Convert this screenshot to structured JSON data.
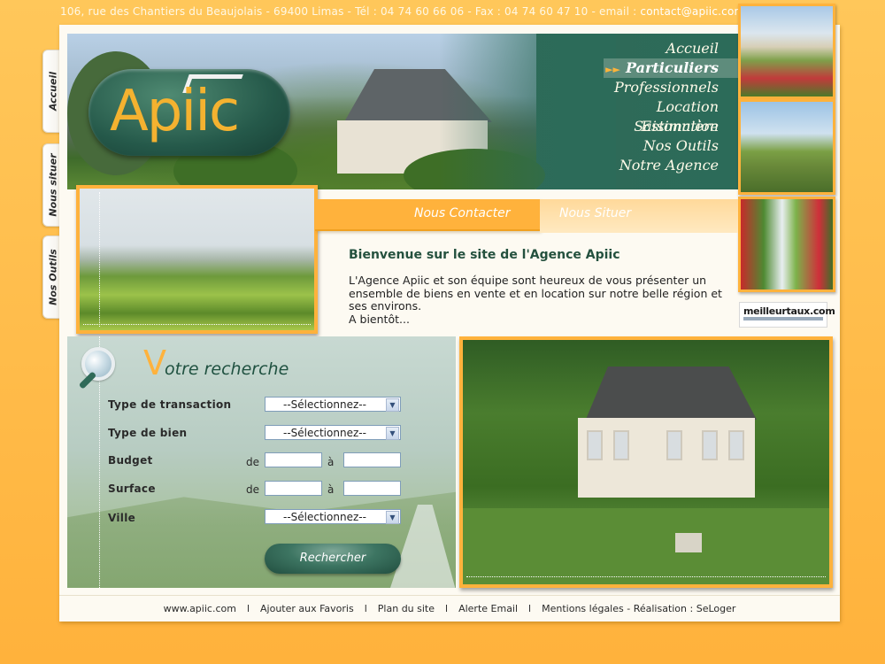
{
  "topbar": {
    "address": "106, rue des Chantiers du Beaujolais - 69400 Limas - Tél : 04 74 60 66 06 - Fax : 04 74 60 47 10 - email : ",
    "email": "contact@apiic.com"
  },
  "side_tabs": [
    "Accueil",
    "Nous situer",
    "Nos Outils"
  ],
  "logo": {
    "text": "Apiic"
  },
  "nav": {
    "items": [
      "Accueil",
      "Particuliers",
      "Professionnels",
      "Location Saisonnière",
      "Estimation",
      "Nos Outils",
      "Notre Agence"
    ],
    "active_index": 1
  },
  "ad_banner": {
    "brand": "meilleurtaux.com"
  },
  "contact_tabs": {
    "contact": "Nous Contacter",
    "situer": "Nous Situer"
  },
  "welcome": {
    "title": "Bienvenue sur le site de l'Agence Apiic",
    "text": "L'Agence Apiic et son équipe sont heureux de vous présenter un ensemble de biens  en vente et en location sur notre belle région et ses environs.",
    "sign": "A bientôt..."
  },
  "search": {
    "title_first": "V",
    "title_rest": "otre recherche",
    "fields": {
      "transaction_label": "Type de transaction",
      "bien_label": "Type de bien",
      "budget_label": "Budget",
      "surface_label": "Surface",
      "ville_label": "Ville",
      "de": "de",
      "a": "à",
      "select_placeholder": "--Sélectionnez--"
    },
    "button": "Rechercher"
  },
  "footer": {
    "links": [
      "www.apiic.com",
      "Ajouter aux Favoris",
      "Plan du site",
      "Alerte Email",
      "Mentions légales - Réalisation : SeLoger"
    ],
    "separator": "l"
  },
  "colors": {
    "orange": "#ffb23c",
    "green": "#2c6b59",
    "title_green": "#24513f"
  }
}
